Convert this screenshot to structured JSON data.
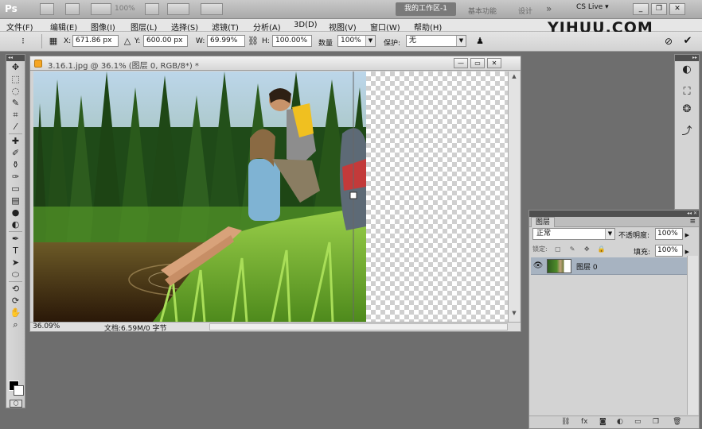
{
  "app": {
    "logo": "Ps",
    "zoom_level": "100%",
    "workspaces": {
      "active": "我的工作区-1",
      "basic": "基本功能",
      "design": "设计"
    },
    "more": "»",
    "cslive": "CS Live ▾",
    "window_controls": [
      "_",
      "❐",
      "✕"
    ]
  },
  "menu": [
    "文件(F)",
    "编辑(E)",
    "图像(I)",
    "图层(L)",
    "选择(S)",
    "滤镜(T)",
    "分析(A)",
    "3D(D)",
    "视图(V)",
    "窗口(W)",
    "帮助(H)"
  ],
  "watermark": "YIHUU.COM",
  "options": {
    "x_label": "X:",
    "x_value": "671.86 px",
    "y_label": "Y:",
    "y_value": "600.00 px",
    "w_label": "W:",
    "w_value": "69.99%",
    "h_label": "H:",
    "h_value": "100.00%",
    "qty_label": "数量",
    "qty_value": "100%",
    "protect_label": "保护:",
    "protect_value": "无"
  },
  "document": {
    "title": "3.16.1.jpg @ 36.1% (图层 0, RGB/8*) *",
    "zoom": "36.09%",
    "doc_size": "文档:6.59M/0 字节"
  },
  "layers_panel": {
    "tab": "图层",
    "blend_mode": "正常",
    "opacity_label": "不透明度:",
    "opacity_value": "100%",
    "lock_label": "锁定:",
    "fill_label": "填充:",
    "fill_value": "100%",
    "layer_name": "图层 0"
  }
}
